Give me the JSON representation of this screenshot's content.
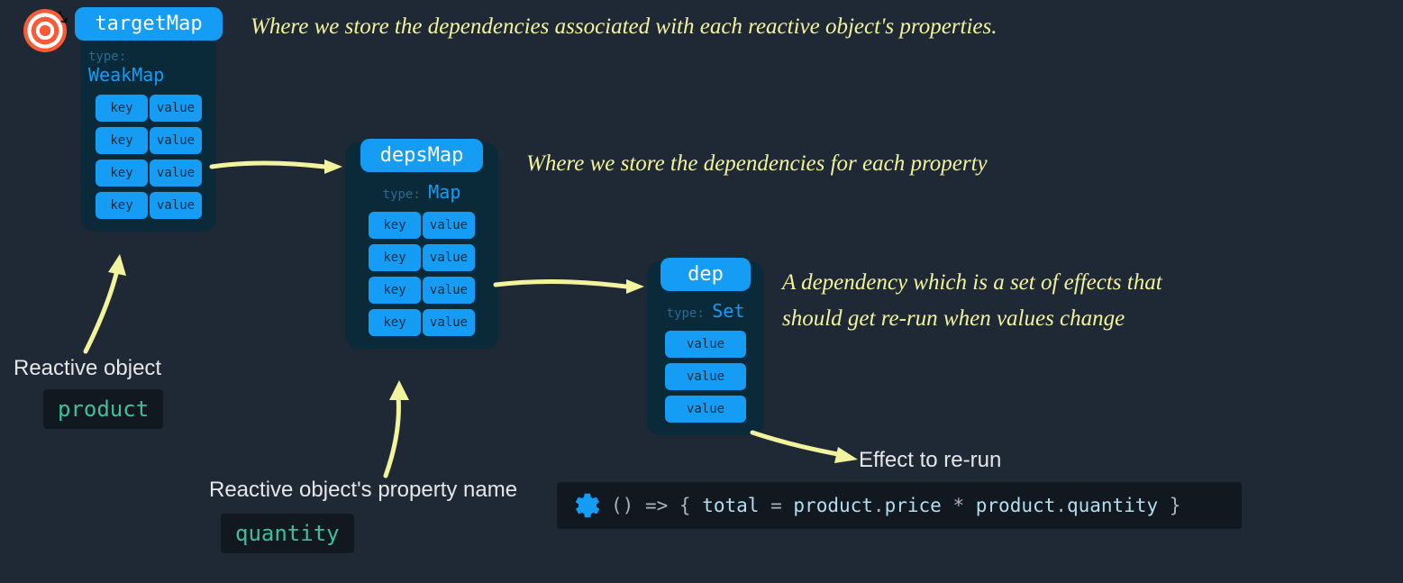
{
  "icons": {
    "dart": "🎯"
  },
  "targetMap": {
    "title": "targetMap",
    "typeLabel": "type:",
    "typeName": "WeakMap",
    "description": "Where we store the dependencies associated with each reactive object's properties.",
    "rows": [
      {
        "key": "key",
        "value": "value"
      },
      {
        "key": "key",
        "value": "value"
      },
      {
        "key": "key",
        "value": "value"
      },
      {
        "key": "key",
        "value": "value"
      }
    ]
  },
  "depsMap": {
    "title": "depsMap",
    "typeLabel": "type:",
    "typeName": "Map",
    "description": "Where we store the dependencies for each property",
    "rows": [
      {
        "key": "key",
        "value": "value"
      },
      {
        "key": "key",
        "value": "value"
      },
      {
        "key": "key",
        "value": "value"
      },
      {
        "key": "key",
        "value": "value"
      }
    ]
  },
  "dep": {
    "title": "dep",
    "typeLabel": "type:",
    "typeName": "Set",
    "descriptionLine1": "A dependency which is a set of effects that",
    "descriptionLine2": "should get re-run when values change",
    "values": [
      "value",
      "value",
      "value"
    ]
  },
  "labels": {
    "reactiveObject": "Reactive object",
    "reactiveObjectCode": "product",
    "propertyName": "Reactive object's property name",
    "propertyNameCode": "quantity",
    "effectLabel": "Effect to re-run"
  },
  "codeTokens": {
    "t1": "()",
    "t2": "=>",
    "t3": "{",
    "t4": "total",
    "t5": "=",
    "t6": "product",
    "t7": ".",
    "t8": "price",
    "t9": "*",
    "t10": "product",
    "t11": ".",
    "t12": "quantity",
    "t13": "}"
  }
}
